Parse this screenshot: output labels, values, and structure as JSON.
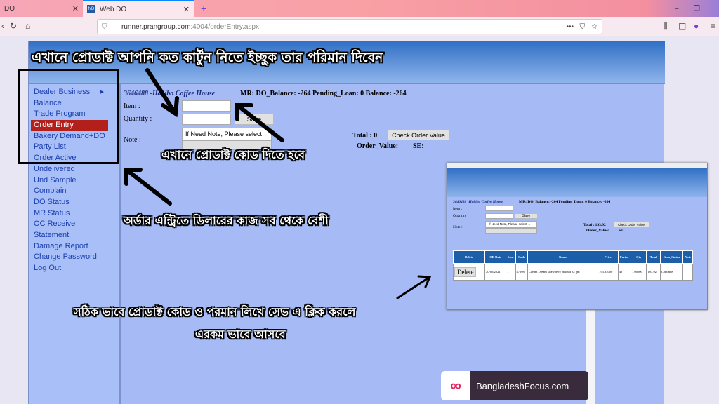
{
  "browser": {
    "tabs": [
      {
        "label": "DO"
      },
      {
        "label": "Web DO"
      }
    ],
    "new_tab": "+",
    "url_host": "runner.prangroup.com",
    "url_path": ":4004/orderEntry.aspx"
  },
  "sidebar": {
    "items": [
      {
        "label": "Dealer Business",
        "submenu": true
      },
      {
        "label": "Balance"
      },
      {
        "label": "Trade Program"
      },
      {
        "label": "Order Entry",
        "selected": true
      },
      {
        "label": "Bakery Demand+DO"
      },
      {
        "label": "Party List"
      },
      {
        "label": "Order Active"
      },
      {
        "label": "Undelivered"
      },
      {
        "label": "Und Sample"
      },
      {
        "label": "Complain"
      },
      {
        "label": "DO Status"
      },
      {
        "label": "MR Status"
      },
      {
        "label": "OC Receive"
      },
      {
        "label": "Statement"
      },
      {
        "label": "Damage Report"
      },
      {
        "label": "Change Password"
      },
      {
        "label": "Log Out"
      }
    ]
  },
  "form": {
    "shop": "3646488 -Habiba Coffee House",
    "balance_line": "MR: DO_Balance: -264  Pending_Loan: 0  Balance: -264",
    "item_label": "Item :",
    "quantity_label": "Quantity :",
    "note_label": "Note :",
    "save": "Save",
    "note_select": "If Need Note, Please select",
    "total": "Total : 0",
    "check_order": "Check Order Value",
    "order_value": "Order_Value:",
    "se": "SE:"
  },
  "inset": {
    "shop": "3646488 -Habiba Coffee House",
    "balance_line": "MR: DO_Balance: -264  Pending_Loan: 0  Balance: -264",
    "item_label": "Item :",
    "quantity_label": "Quantity :",
    "note_label": "Note :",
    "save": "Save",
    "note_select": "If Need Note, Please select ⌄",
    "total": "Total : 193.92",
    "check_order": "Check Order Value",
    "order_value": "Order_Value:",
    "se": "SE:",
    "columns": [
      "Delete",
      "OR Date",
      "Line",
      "Code",
      "Name",
      "Price",
      "Factor",
      "Qty",
      "Total",
      "Item_Status",
      "Note"
    ],
    "rows": [
      {
        "delete": "Delete",
        "date": "20/05/2021",
        "line": "1",
        "code": "47698",
        "name": "Cream Dream strawberry Biscuit 32 gm",
        "price": "193.92000",
        "factor": "48",
        "qty": "1.00000",
        "total": "193.92",
        "status": "Continue",
        "note": ""
      }
    ]
  },
  "overlay": {
    "top": "এখানে প্রোডাক্ট আপনি কত কার্টুন নিতে ইচ্ছুক তার পরিমান দিবেন",
    "code": "এখানে প্রোডাক্ট কোড দিতে হবে",
    "dealer": "অর্ডার এন্ট্রিতে ডিলারের কাজ সব থেকে বেশী",
    "bottom1": "সঠিক ভাবে প্রোডাক্ট কোড ও পরমান লিখে সেভ এ ক্লিক করলে",
    "bottom2": "এরকম ভাবে আসবে"
  },
  "brand": {
    "name": "BangladeshFocus.com",
    "icon": "link-icon"
  }
}
